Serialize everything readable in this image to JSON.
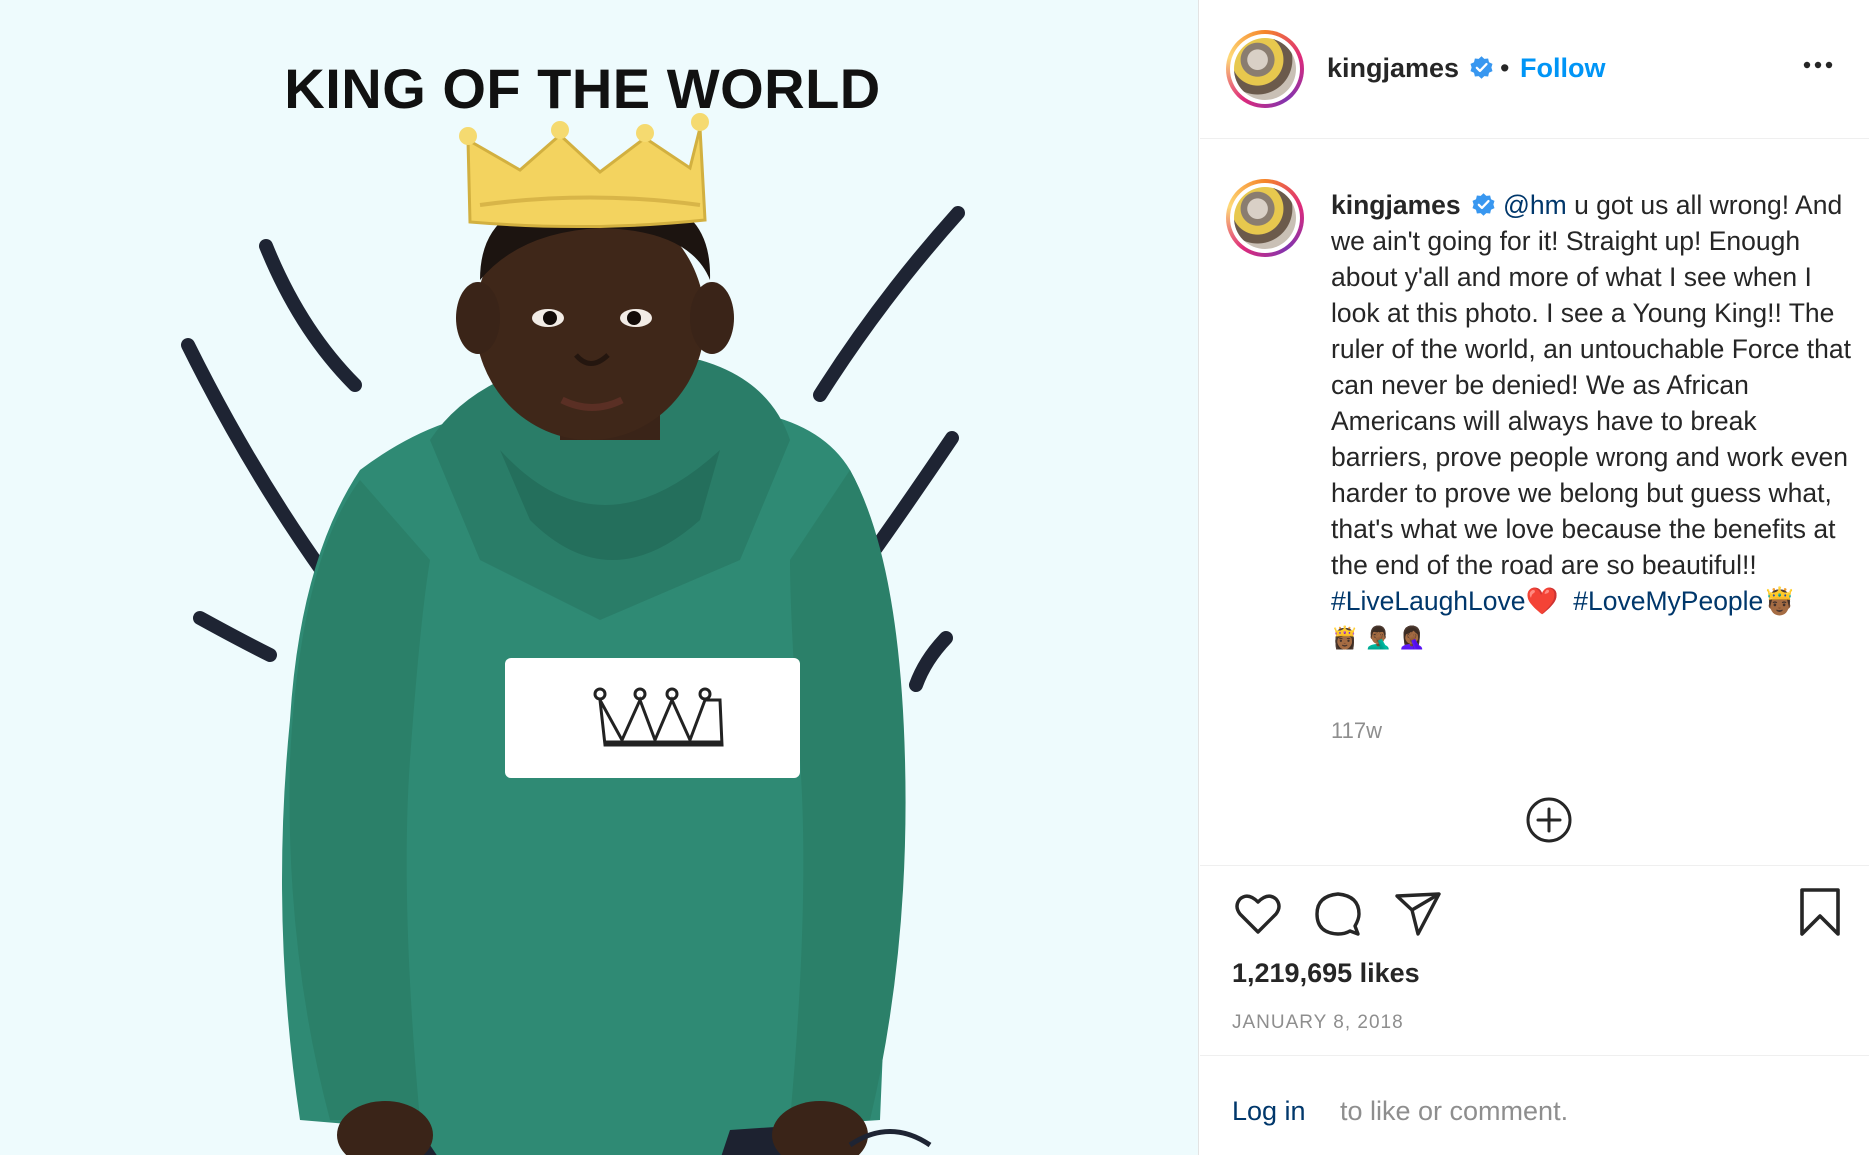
{
  "post": {
    "image": {
      "headline": "KING OF THE WORLD",
      "alt_subject": "boy-in-green-hoodie-with-crown"
    },
    "header": {
      "username": "kingjames",
      "separator": "•",
      "follow_label": "Follow",
      "verified_icon": "verified-badge-icon",
      "more_icon": "more-options-icon"
    },
    "caption": {
      "username": "kingjames",
      "mention": "@hm",
      "text": " u got us all wrong! And we ain't going for it! Straight up! Enough about y'all and more of what I see when I look at this photo. I see a Young King!! The ruler of the world, an untouchable Force that can never be denied! We as African Americans will always have to break barriers, prove people wrong and work even harder to prove we belong but guess what, that's what we love because the benefits at the end of the road are so beautiful!! ",
      "hashtag_1": "#LiveLaughLove",
      "emoji_1": "❤️",
      "hashtag_2": "#LoveMyPeople",
      "emoji_2": "🤴🏾",
      "emoji_row": "👸🏾 🤦🏾‍♂️ 🤦🏾‍♀️",
      "age": "117w"
    },
    "actions": {
      "like_icon": "heart-icon",
      "comment_icon": "comment-icon",
      "share_icon": "share-icon",
      "save_icon": "bookmark-icon",
      "load_more_icon": "plus-circle-icon"
    },
    "likes": "1,219,695 likes",
    "date": "JANUARY 8, 2018",
    "login": {
      "link": "Log in",
      "rest": "to like or comment."
    },
    "colors": {
      "accent": "#0095f6",
      "link": "#00376b",
      "muted": "#8e8e8e",
      "hoodie": "#2f8a74",
      "crown": "#f3d35f"
    }
  }
}
